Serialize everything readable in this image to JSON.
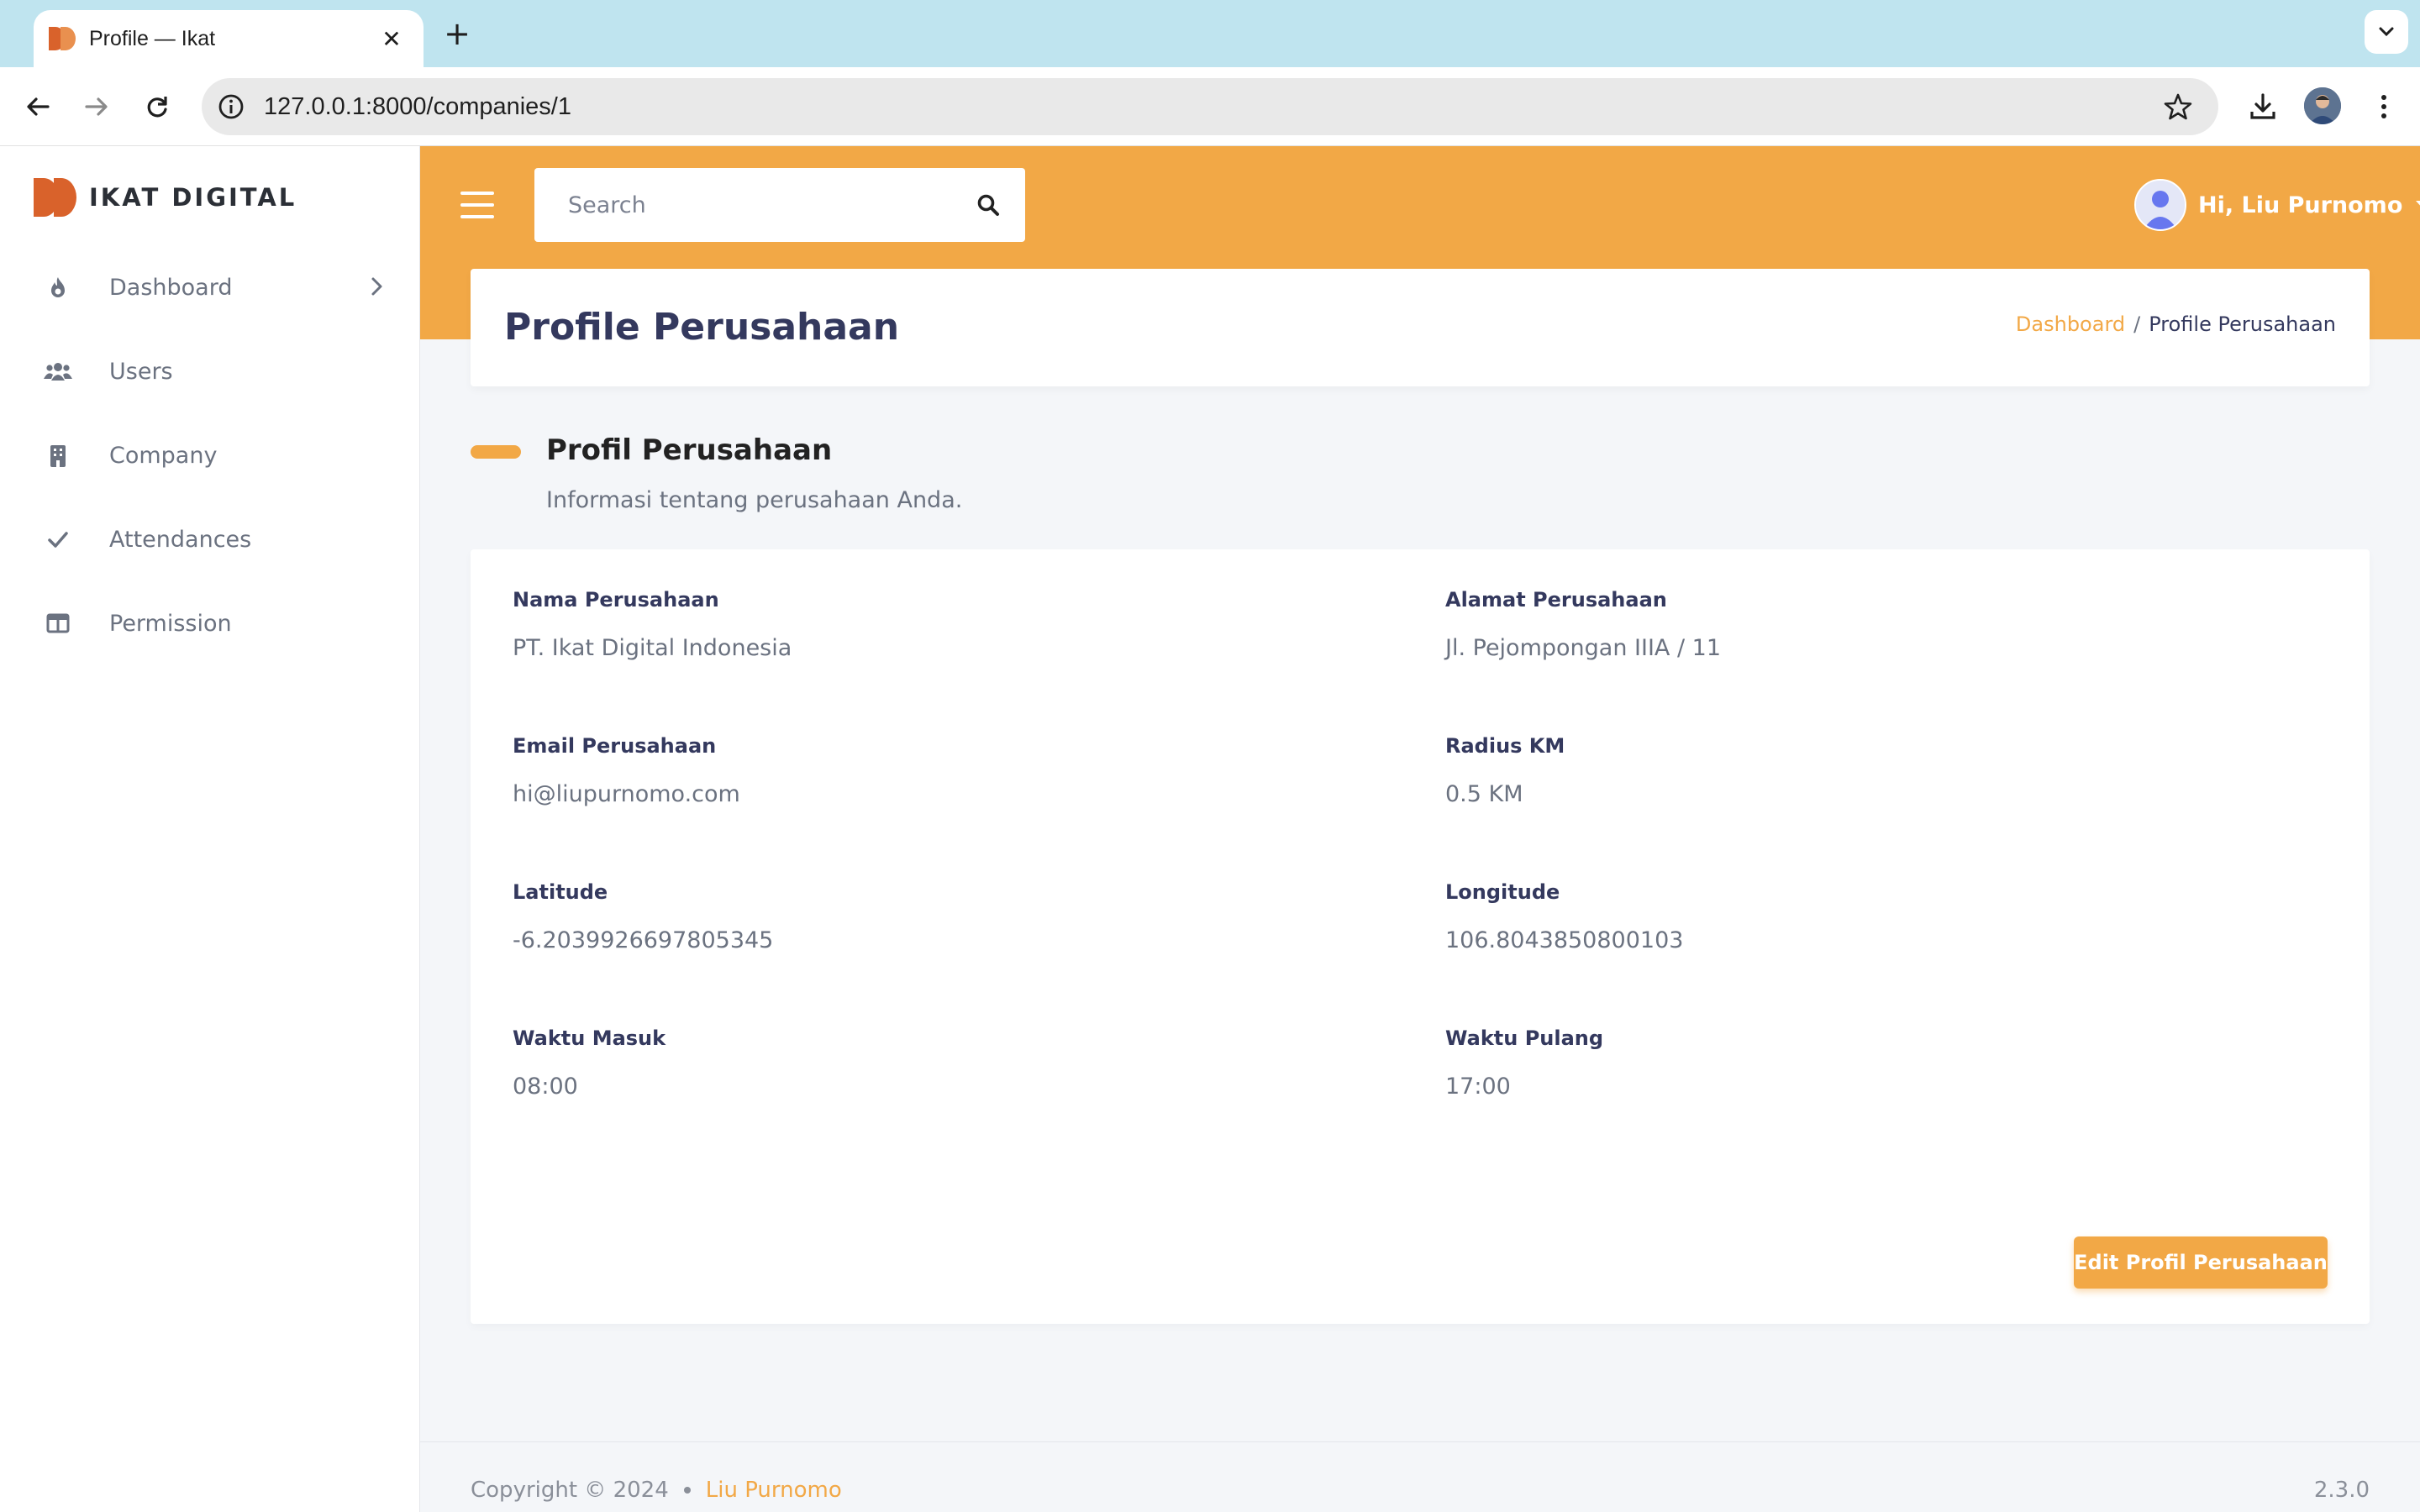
{
  "browser": {
    "tab_title": "Profile — Ikat",
    "tab_close": "✕",
    "new_tab": "+",
    "url": "127.0.0.1:8000/companies/1"
  },
  "app": {
    "brand": "IKAT DIGITAL",
    "colors": {
      "accent": "#f2a846",
      "heading": "#34395e",
      "brand_logo": "#d9622b"
    }
  },
  "sidebar": {
    "items": [
      {
        "label": "Dashboard",
        "icon": "fire-icon",
        "has_chevron": true
      },
      {
        "label": "Users",
        "icon": "users-icon"
      },
      {
        "label": "Company",
        "icon": "building-icon"
      },
      {
        "label": "Attendances",
        "icon": "check-icon"
      },
      {
        "label": "Permission",
        "icon": "columns-icon"
      }
    ]
  },
  "topbar": {
    "search_placeholder": "Search",
    "user_greeting": "Hi, Liu Purnomo"
  },
  "header": {
    "title": "Profile Perusahaan",
    "breadcrumb": {
      "home": "Dashboard",
      "separator": "/",
      "current": "Profile Perusahaan"
    }
  },
  "section": {
    "title": "Profil Perusahaan",
    "lead": "Informasi tentang perusahaan Anda."
  },
  "profile": {
    "fields": [
      {
        "label": "Nama Perusahaan",
        "value": "PT. Ikat Digital Indonesia"
      },
      {
        "label": "Alamat Perusahaan",
        "value": "Jl. Pejompongan IIIA / 11"
      },
      {
        "label": "Email Perusahaan",
        "value": "hi@liupurnomo.com"
      },
      {
        "label": "Radius KM",
        "value": "0.5 KM"
      },
      {
        "label": "Latitude",
        "value": "-6.2039926697805345"
      },
      {
        "label": "Longitude",
        "value": "106.8043850800103"
      },
      {
        "label": "Waktu Masuk",
        "value": "08:00"
      },
      {
        "label": "Waktu Pulang",
        "value": "17:00"
      }
    ],
    "edit_button": "Edit Profil Perusahaan"
  },
  "footer": {
    "copyright": "Copyright © 2024",
    "author": "Liu Purnomo",
    "version": "2.3.0"
  }
}
